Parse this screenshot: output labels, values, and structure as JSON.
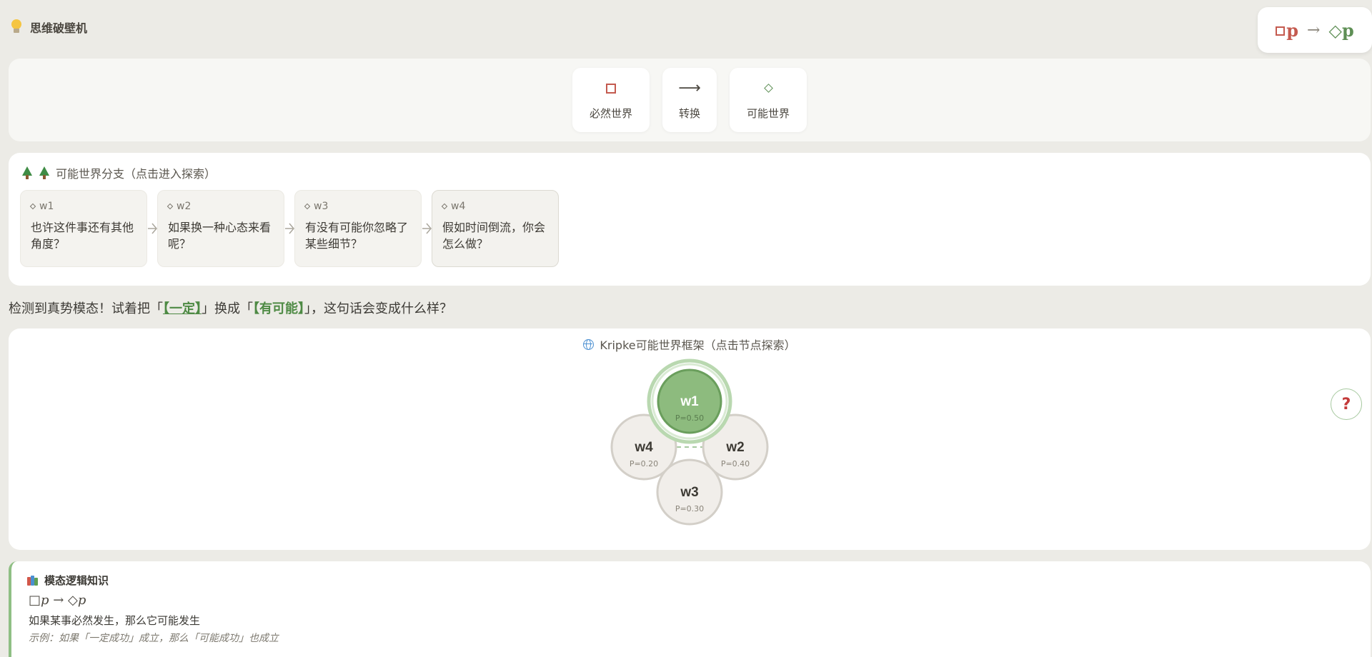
{
  "header": {
    "title": "思维破壁机",
    "formula": {
      "box_p": "p",
      "arrow": "→",
      "dia_p": "◇p"
    }
  },
  "toolbar": {
    "buttons": [
      {
        "label": "必然世界",
        "glyph": "square"
      },
      {
        "label": "转换",
        "glyph": "⟶"
      },
      {
        "label": "可能世界",
        "glyph": "diamond"
      }
    ]
  },
  "branches": {
    "title": "可能世界分支（点击进入探索）",
    "items": [
      {
        "id": "w1",
        "text": "也许这件事还有其他角度？"
      },
      {
        "id": "w2",
        "text": "如果换一种心态来看呢？"
      },
      {
        "id": "w3",
        "text": "有没有可能你忽略了某些细节？"
      },
      {
        "id": "w4",
        "text": "假如时间倒流，你会怎么做？"
      }
    ]
  },
  "hint": {
    "prefix": "检测到真势模态！试着把「",
    "kw1": "【一定】",
    "mid": "」换成「",
    "kw2": "【有可能】",
    "suffix": "」，这句话会变成什么样？"
  },
  "kripke": {
    "title": "Kripke可能世界框架（点击节点探索）",
    "nodes": [
      {
        "id": "w1",
        "p": "P=0.50",
        "active": true
      },
      {
        "id": "w2",
        "p": "P=0.40",
        "active": false
      },
      {
        "id": "w3",
        "p": "P=0.30",
        "active": false
      },
      {
        "id": "w4",
        "p": "P=0.20",
        "active": false
      }
    ],
    "help": "?"
  },
  "knowledge": {
    "title": "模态逻辑知识",
    "formula": "□p → ◇p",
    "description": "如果某事必然发生，那么它可能发生",
    "example": "示例：如果「一定成功」成立，那么「可能成功」也成立"
  },
  "colors": {
    "necessary": "#c45a4f",
    "possible": "#5e8f55",
    "active_node": "#8dbb7e",
    "inactive_node": "#f1eeea"
  }
}
